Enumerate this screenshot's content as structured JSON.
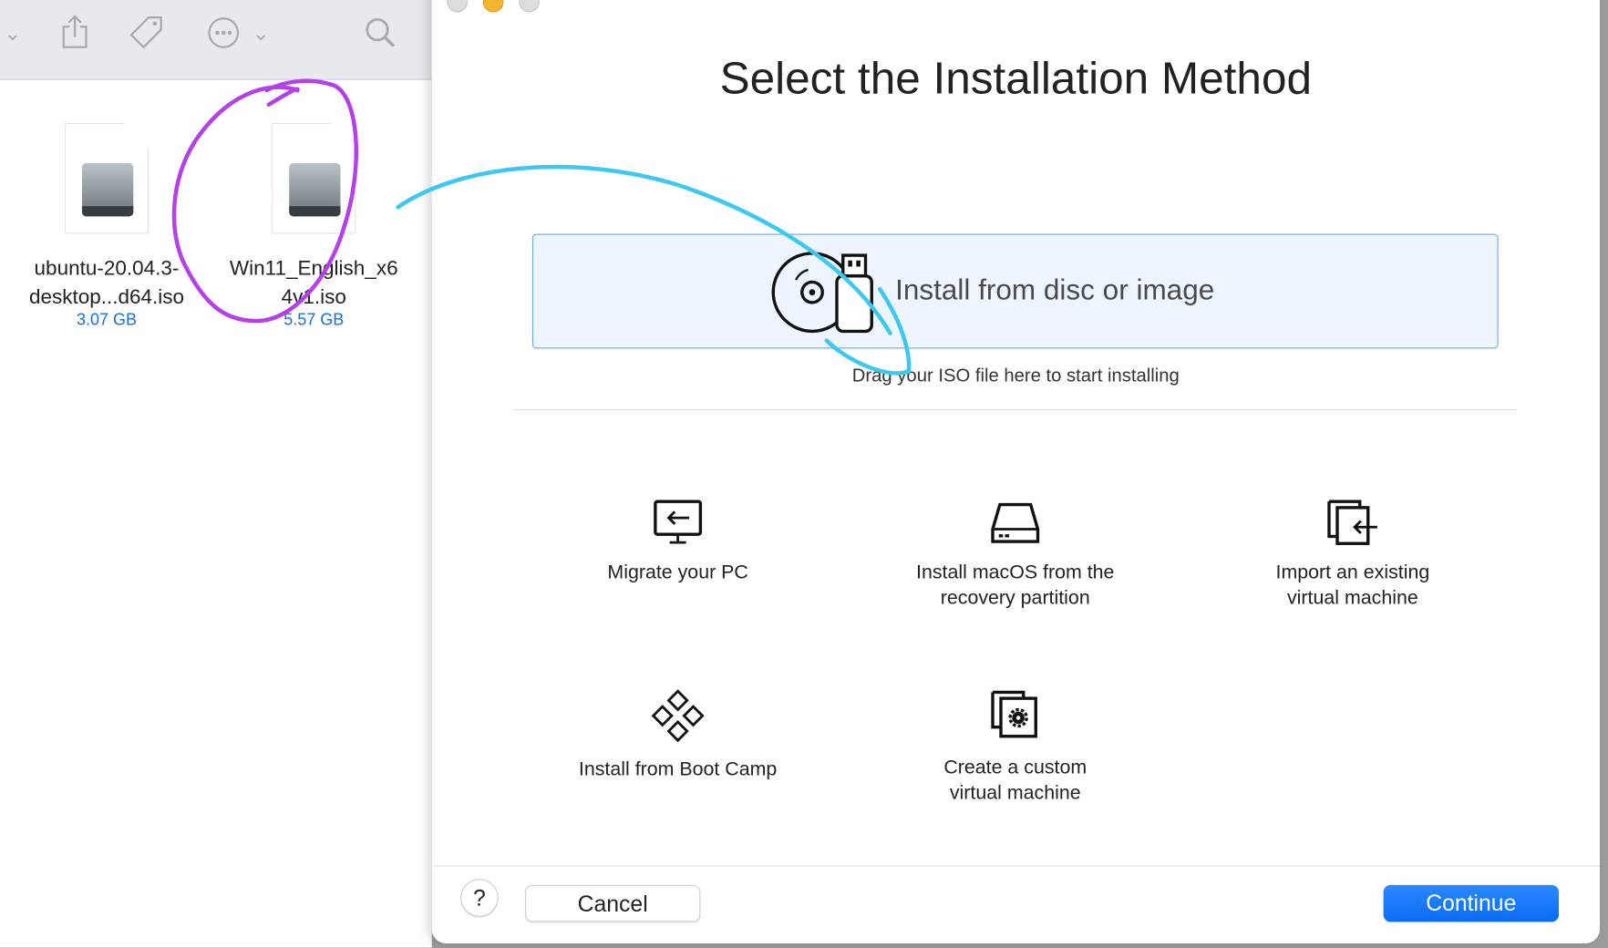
{
  "finder": {
    "toolbar": [
      "chevron-down-icon",
      "share-icon",
      "tag-icon",
      "more-icon",
      "search-icon"
    ],
    "files": [
      {
        "name_line1": "ubuntu-20.04.3-",
        "name_line2": "desktop...d64.iso",
        "size": "3.07 GB"
      },
      {
        "name_line1": "Win11_English_x6",
        "name_line2": "4v1.iso",
        "size": "5.57 GB"
      }
    ]
  },
  "dialog": {
    "title": "Select the Installation Method",
    "drop": {
      "label": "Install from disc or image",
      "hint": "Drag your ISO file here to start installing"
    },
    "options": [
      {
        "icon": "migrate-pc-icon",
        "line1": "Migrate your PC",
        "line2": ""
      },
      {
        "icon": "hard-drive-icon",
        "line1": "Install macOS from the",
        "line2": "recovery partition"
      },
      {
        "icon": "import-vm-icon",
        "line1": "Import an existing",
        "line2": "virtual machine"
      },
      {
        "icon": "boot-camp-icon",
        "line1": "Install from Boot Camp",
        "line2": ""
      },
      {
        "icon": "custom-vm-icon",
        "line1": "Create a custom",
        "line2": "virtual machine"
      }
    ],
    "help": "?",
    "cancel": "Cancel",
    "continue": "Continue"
  },
  "colors": {
    "accent": "#0a6cf5",
    "annotation_circle": "#b540e8",
    "annotation_arrow": "#3cc8f0"
  }
}
